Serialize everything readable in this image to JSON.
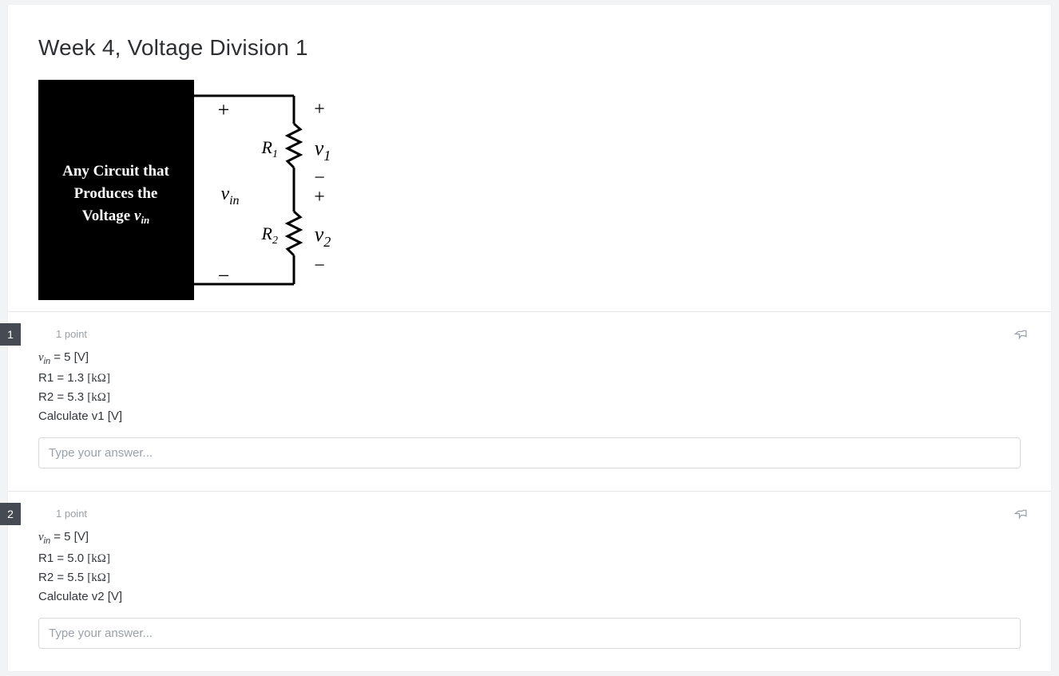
{
  "title": "Week 4, Voltage Division 1",
  "diagram": {
    "box_line1": "Any Circuit that",
    "box_line2": "Produces the",
    "box_line3_a": "Voltage ",
    "box_line3_b": "v",
    "box_line3_c": "in",
    "vin": "v",
    "vin_sub": "in",
    "R1": "R",
    "R1_sub": "1",
    "R2": "R",
    "R2_sub": "2",
    "v1": "v",
    "v1_sub": "1",
    "v2": "v",
    "v2_sub": "2",
    "plus": "+",
    "minus": "−"
  },
  "questions": [
    {
      "num": "1",
      "points": "1 point",
      "lines": {
        "vin_val": " = 5 [V]",
        "r1": "R1 = 1.3 ",
        "r1_unit": "[kΩ]",
        "r2": "R2 = 5.3 ",
        "r2_unit": "[kΩ]",
        "calc": "Calculate v1 [V]"
      },
      "placeholder": "Type your answer..."
    },
    {
      "num": "2",
      "points": "1 point",
      "lines": {
        "vin_val": " = 5 [V]",
        "r1": "R1 = 5.0 ",
        "r1_unit": "[kΩ]",
        "r2": "R2 = 5.5 ",
        "r2_unit": "[kΩ]",
        "calc": "Calculate v2 [V]"
      },
      "placeholder": "Type your answer..."
    }
  ]
}
